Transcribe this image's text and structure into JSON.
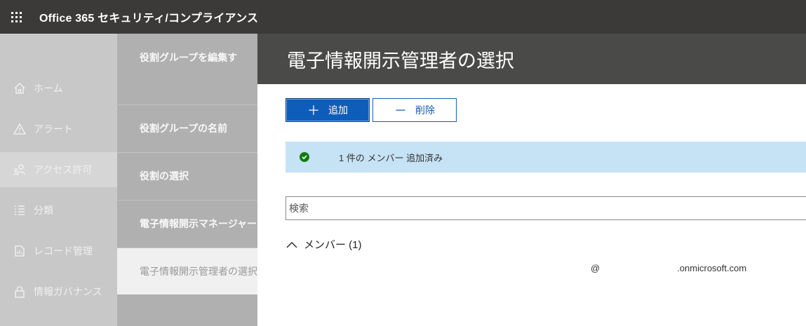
{
  "topbar": {
    "title": "Office 365 セキュリティ/コンプライアンス",
    "menu_icon": "waffle-icon"
  },
  "nav": {
    "items": [
      {
        "label": "ホーム",
        "icon": "home-icon"
      },
      {
        "label": "アラート",
        "icon": "alert-icon"
      },
      {
        "label": "アクセス許可",
        "icon": "people-icon",
        "active": true
      },
      {
        "label": "分類",
        "icon": "list-icon"
      },
      {
        "label": "レコード管理",
        "icon": "records-icon"
      },
      {
        "label": "情報ガバナンス",
        "icon": "lock-icon"
      }
    ]
  },
  "wizard": {
    "steps": [
      {
        "label": "役割グループを編集す"
      },
      {
        "label": "役割グループの名前"
      },
      {
        "label": "役割の選択"
      },
      {
        "label": "電子情報開示マネージャー"
      },
      {
        "label": "電子情報開示管理者の選択",
        "current": true
      }
    ]
  },
  "panel": {
    "title": "電子情報開示管理者の選択",
    "add_button": "追加",
    "remove_button": "削除",
    "notice": "1 件の メンバー 追加済み",
    "search_placeholder": "検索",
    "group_label": "メンバー (1)",
    "member": {
      "prefix": "@",
      "suffix": ".onmicrosoft.com"
    }
  },
  "colors": {
    "accent": "#0f5dbb",
    "success": "#107c10",
    "notice_bg": "#c6e2f5",
    "topbar": "#3b3a39"
  }
}
